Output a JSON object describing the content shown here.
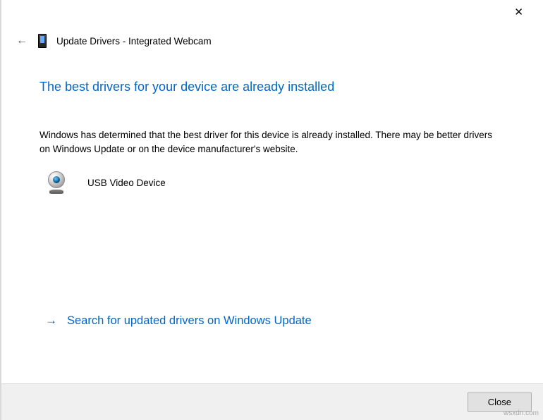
{
  "titlebar": {
    "close_symbol": "✕"
  },
  "header": {
    "back_symbol": "←",
    "title": "Update Drivers - Integrated Webcam"
  },
  "main": {
    "heading": "The best drivers for your device are already installed",
    "description": "Windows has determined that the best driver for this device is already installed. There may be better drivers on Windows Update or on the device manufacturer's website.",
    "device_name": "USB Video Device",
    "link_arrow": "→",
    "link_text": "Search for updated drivers on Windows Update"
  },
  "footer": {
    "close_label": "Close"
  },
  "watermark": "wsxdn.com"
}
